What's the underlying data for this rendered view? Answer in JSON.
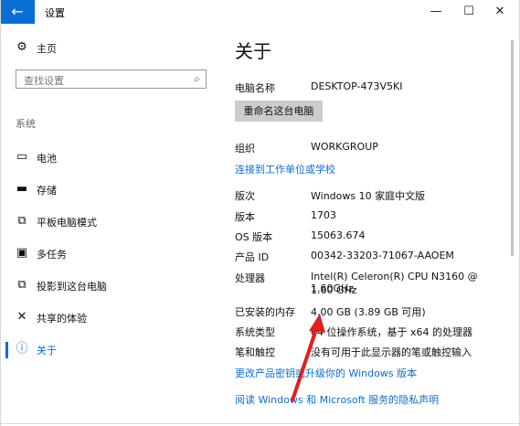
{
  "window": {
    "title": "设置",
    "back_icon": "←",
    "minimize_icon": "—",
    "maximize_icon": "☐",
    "close_icon": "✕"
  },
  "sidebar": {
    "home": {
      "icon": "gear-icon",
      "glyph": "⚙",
      "label": "主页"
    },
    "search_placeholder": "查找设置",
    "search_glyph": "⌕",
    "section": "系统",
    "items": [
      {
        "icon": "battery-icon",
        "glyph": "▭",
        "label": "电池"
      },
      {
        "icon": "storage-icon",
        "glyph": "▬",
        "label": "存储"
      },
      {
        "icon": "tablet-mode-icon",
        "glyph": "⧉",
        "label": "平板电脑模式"
      },
      {
        "icon": "multitask-icon",
        "glyph": "▣",
        "label": "多任务"
      },
      {
        "icon": "project-icon",
        "glyph": "⧉",
        "label": "投影到这台电脑"
      },
      {
        "icon": "shared-experience-icon",
        "glyph": "✕",
        "label": "共享的体验"
      },
      {
        "icon": "info-icon",
        "glyph": "ⓘ",
        "label": "关于"
      }
    ],
    "active_index": 6
  },
  "main": {
    "title": "关于",
    "pc_name_label": "电脑名称",
    "pc_name_value": "DESKTOP-473V5KI",
    "rename_button": "重命名这台电脑",
    "org_label": "组织",
    "org_value": "WORKGROUP",
    "connect_link": "连接到工作单位或学校",
    "specs": [
      {
        "label": "版次",
        "value": "Windows 10 家庭中文版"
      },
      {
        "label": "版本",
        "value": "1703"
      },
      {
        "label": "OS 版本",
        "value": "15063.674"
      },
      {
        "label": "产品 ID",
        "value": "00342-33203-71067-AAOEM"
      },
      {
        "label": "处理器",
        "value": "Intel(R) Celeron(R) CPU  N3160  @ 1.60GHz",
        "value2": "1.60 GHz"
      },
      {
        "label": "已安装的内存",
        "value": "4.00 GB (3.89 GB 可用)"
      },
      {
        "label": "系统类型",
        "value": "64 位操作系统，基于 x64 的处理器"
      },
      {
        "label": "笔和触控",
        "value": "没有可用于此显示器的笔或触控输入"
      }
    ],
    "product_key_link": "更改产品密钥或升级你的 Windows 版本",
    "privacy_link": "阅读 Windows 和 Microsoft 服务的隐私声明"
  },
  "annotation": {
    "arrow_color": "#e0201c"
  },
  "colors": {
    "accent": "#0a6fd4"
  }
}
